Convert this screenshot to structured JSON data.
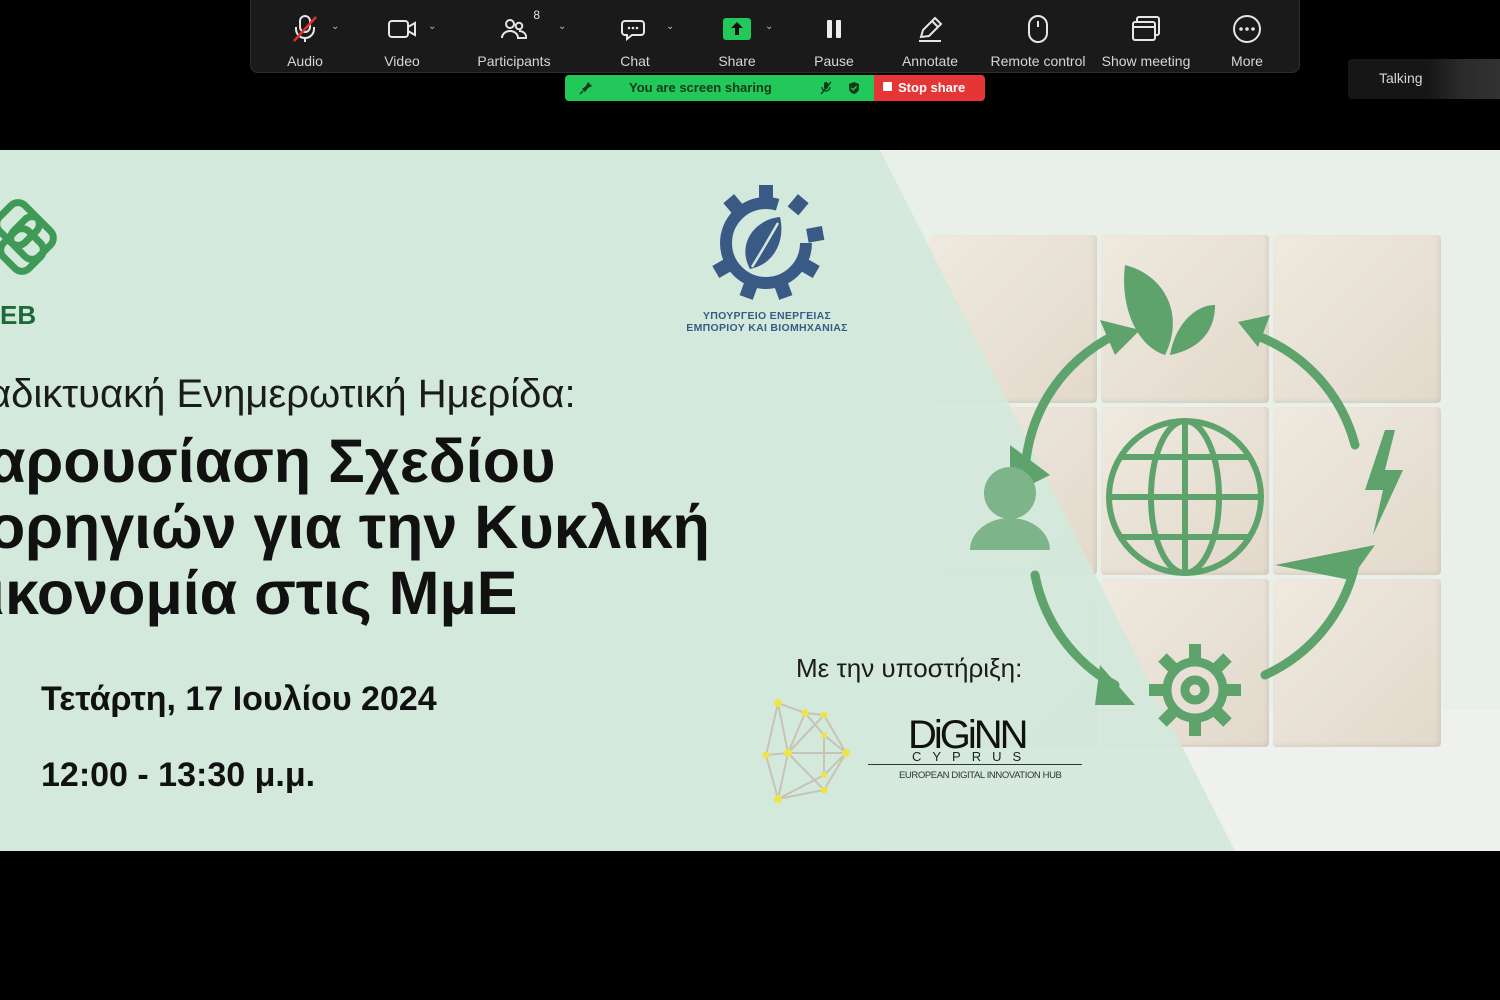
{
  "toolbar": {
    "audio": {
      "label": "Audio",
      "icon": "mic-muted-icon"
    },
    "video": {
      "label": "Video",
      "icon": "video-camera-icon"
    },
    "participants": {
      "label": "Participants",
      "count": "8",
      "icon": "participants-icon"
    },
    "chat": {
      "label": "Chat",
      "icon": "chat-bubble-icon"
    },
    "share": {
      "label": "Share",
      "icon": "share-screen-icon"
    },
    "pause": {
      "label": "Pause",
      "icon": "pause-icon"
    },
    "annotate": {
      "label": "Annotate",
      "icon": "pencil-icon"
    },
    "remote_control": {
      "label": "Remote control",
      "icon": "mouse-icon"
    },
    "show_meeting": {
      "label": "Show meeting",
      "icon": "window-icon"
    },
    "more": {
      "label": "More",
      "icon": "ellipsis-icon"
    }
  },
  "share_banner": {
    "status": "You are screen sharing",
    "stop_label": "Stop share"
  },
  "talking_indicator": "Talking",
  "slide": {
    "org_left_text": "EB",
    "ministry_line1": "ΥΠΟΥΡΓΕΙΟ ΕΝΕΡΓΕΙΑΣ",
    "ministry_line2": "ΕΜΠΟΡΙΟΥ ΚΑΙ ΒΙΟΜΗΧΑΝΙΑΣ",
    "subtitle": "αδικτυακή Ενημερωτική Ημερίδα:",
    "title_line1": "αρουσίαση Σχεδίου",
    "title_line2": "ορηγιών για την Κυκλική",
    "title_line3": "ικονομία στις ΜμΕ",
    "date": "Τετάρτη, 17 Ιουλίου 2024",
    "time": "12:00 - 13:30 μ.μ.",
    "support_label": "Με την υποστήριξη:",
    "diginn_name": "DiGiNN",
    "diginn_country": "CYPRUS",
    "diginn_tagline": "EUROPEAN DIGITAL INNOVATION HUB"
  },
  "colors": {
    "toolbar_bg": "#1a1a1a",
    "sharing_green": "#23c85a",
    "stop_red": "#e63535",
    "slide_green": "#3f9a56",
    "ministry_blue": "#3a5a86"
  }
}
